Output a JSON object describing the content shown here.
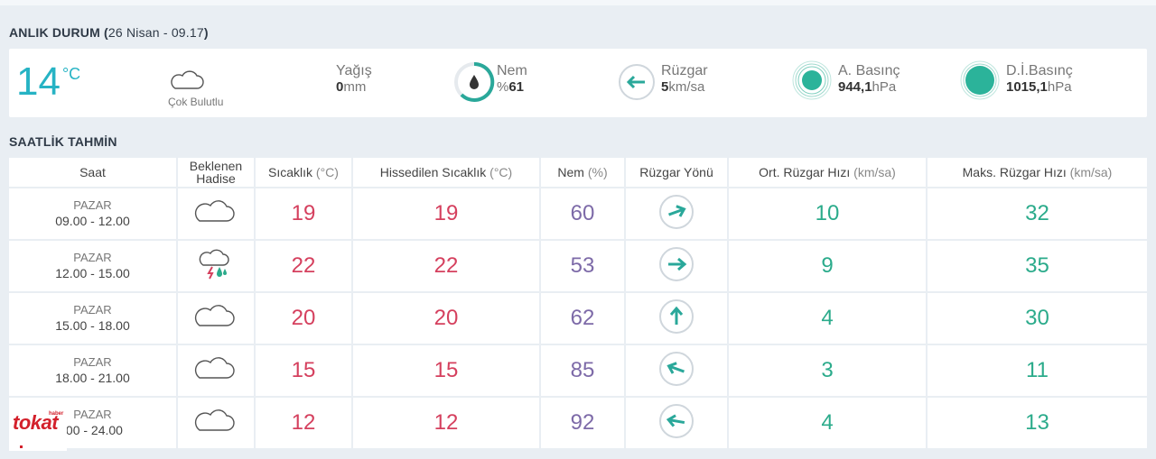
{
  "current": {
    "title": "ANLIK DURUM (",
    "date": "26 Nisan - 09.17",
    "title_close": ")",
    "temp": "14",
    "temp_unit": "°C",
    "condition": "Çok Bulutlu",
    "rain_label": "Yağış",
    "rain_value": "0",
    "rain_unit": "mm",
    "humidity_label": "Nem",
    "humidity_prefix": "%",
    "humidity_value": "61",
    "wind_label": "Rüzgar",
    "wind_value": "5",
    "wind_unit": "km/sa",
    "pressure_label": "A. Basınç",
    "pressure_value": "944,1",
    "pressure_unit": "hPa",
    "sea_pressure_label": "D.İ.Basınç",
    "sea_pressure_value": "1015,1",
    "sea_pressure_unit": "hPa"
  },
  "hourly": {
    "title": "SAATLİK TAHMİN",
    "headers": {
      "time": "Saat",
      "event_1": "Beklenen",
      "event_2": "Hadise",
      "temp": "Sıcaklık",
      "temp_unit": "(°C)",
      "feels": "Hissedilen Sıcaklık",
      "feels_unit": "(°C)",
      "humidity": "Nem",
      "humidity_unit": "(%)",
      "wind_dir": "Rüzgar Yönü",
      "avg_wind": "Ort. Rüzgar Hızı",
      "avg_wind_unit": "(km/sa)",
      "max_wind": "Maks. Rüzgar Hızı",
      "max_wind_unit": "(km/sa)"
    },
    "rows": [
      {
        "day": "PAZAR",
        "range": "09.00 - 12.00",
        "icon": "cloud-icon",
        "temp": "19",
        "feels": "19",
        "humidity": "60",
        "wind_dir_deg": 70,
        "avg": "10",
        "max": "32"
      },
      {
        "day": "PAZAR",
        "range": "12.00 - 15.00",
        "icon": "thunderstorm-icon",
        "temp": "22",
        "feels": "22",
        "humidity": "53",
        "wind_dir_deg": 90,
        "avg": "9",
        "max": "35"
      },
      {
        "day": "PAZAR",
        "range": "15.00 - 18.00",
        "icon": "cloud-icon",
        "temp": "20",
        "feels": "20",
        "humidity": "62",
        "wind_dir_deg": 0,
        "avg": "4",
        "max": "30"
      },
      {
        "day": "PAZAR",
        "range": "18.00 - 21.00",
        "icon": "cloud-icon",
        "temp": "15",
        "feels": "15",
        "humidity": "85",
        "wind_dir_deg": 290,
        "avg": "3",
        "max": "11"
      },
      {
        "day": "PAZAR",
        "range": ".00 - 24.00",
        "icon": "cloud-icon",
        "temp": "12",
        "feels": "12",
        "humidity": "92",
        "wind_dir_deg": 280,
        "avg": "4",
        "max": "13"
      }
    ]
  },
  "watermark": {
    "brand": "tokat",
    "small": "haber"
  },
  "colors": {
    "accent": "#26b3c4",
    "temp": "#d5405e",
    "humidity": "#7d6aa8",
    "wind": "#2bab8b",
    "icon": "#2aa89a"
  }
}
